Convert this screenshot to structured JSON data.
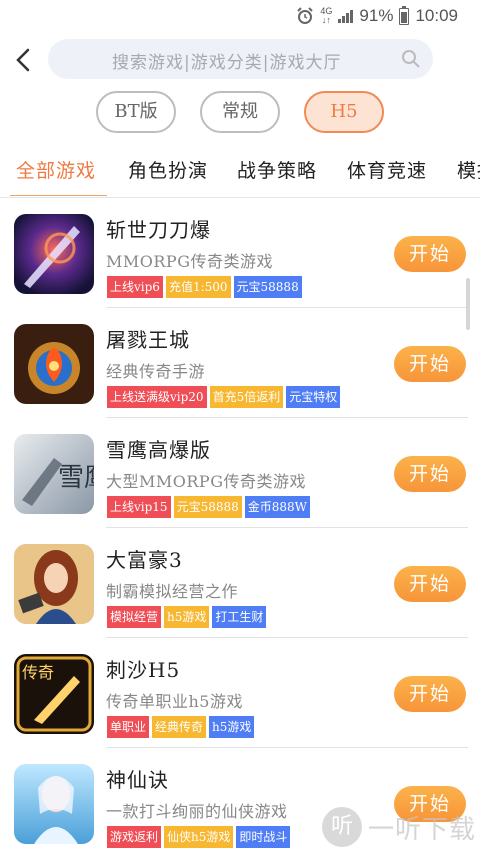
{
  "status_bar": {
    "network": "4G",
    "battery": "91%",
    "time": "10:09"
  },
  "search": {
    "placeholder": "搜索游戏|游戏分类|游戏大厅"
  },
  "versions": [
    "BT版",
    "常规",
    "H5"
  ],
  "active_version": "H5",
  "tabs": [
    "全部游戏",
    "角色扮演",
    "战争策略",
    "体育竞速",
    "模拟"
  ],
  "active_tab": "全部游戏",
  "games": [
    {
      "name": "斩世刀刀爆",
      "desc": "MMORPG传奇类游戏",
      "tags": [
        {
          "text": "上线vip6",
          "color": "red"
        },
        {
          "text": "充值1:500",
          "color": "yellow"
        },
        {
          "text": "元宝58888",
          "color": "blue"
        }
      ],
      "button": "开始"
    },
    {
      "name": "屠戮王城",
      "desc": "经典传奇手游",
      "tags": [
        {
          "text": "上线送满级vip20",
          "color": "red"
        },
        {
          "text": "首充5倍返利",
          "color": "yellow"
        },
        {
          "text": "元宝特权",
          "color": "blue"
        }
      ],
      "button": "开始"
    },
    {
      "name": "雪鹰高爆版",
      "desc": "大型MMORPG传奇类游戏",
      "tags": [
        {
          "text": "上线vip15",
          "color": "red"
        },
        {
          "text": "元宝58888",
          "color": "yellow"
        },
        {
          "text": "金币888W",
          "color": "blue"
        }
      ],
      "button": "开始"
    },
    {
      "name": "大富豪3",
      "desc": "制霸模拟经营之作",
      "tags": [
        {
          "text": "模拟经营",
          "color": "red"
        },
        {
          "text": "h5游戏",
          "color": "yellow"
        },
        {
          "text": "打工生财",
          "color": "blue"
        }
      ],
      "button": "开始"
    },
    {
      "name": "刺沙H5",
      "desc": "传奇单职业h5游戏",
      "tags": [
        {
          "text": "单职业",
          "color": "red"
        },
        {
          "text": "经典传奇",
          "color": "yellow"
        },
        {
          "text": "h5游戏",
          "color": "blue"
        }
      ],
      "button": "开始"
    },
    {
      "name": "神仙诀",
      "desc": "一款打斗绚丽的仙侠游戏",
      "tags": [
        {
          "text": "游戏返利",
          "color": "red"
        },
        {
          "text": "仙侠h5游戏",
          "color": "yellow"
        },
        {
          "text": "即时战斗",
          "color": "blue"
        }
      ],
      "button": "开始"
    }
  ],
  "thumb_labels": {
    "game3": "雪鹰",
    "game5": "传奇"
  },
  "watermark": {
    "icon": "听",
    "text": "一听下载"
  },
  "colors": {
    "accent": "#ef7a43",
    "button": "#f7953a",
    "tag_red": "#ef4e56",
    "tag_yellow": "#f7b731",
    "tag_blue": "#4f7df5"
  }
}
